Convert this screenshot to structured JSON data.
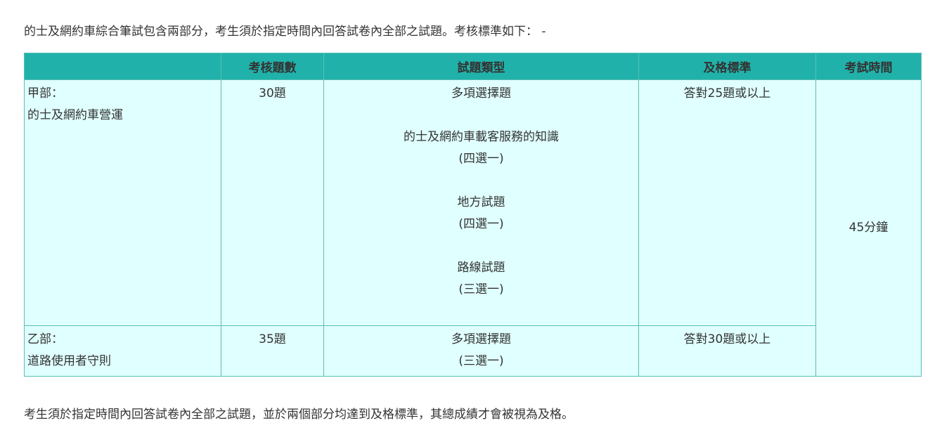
{
  "intro": "的士及網約車綜合筆試包含兩部分，考生須於指定時間內回答試卷內全部之試題。考核標準如下： -",
  "table": {
    "headers": [
      "",
      "考核題數",
      "試題類型",
      "及格標準",
      "考試時間"
    ],
    "rows": [
      {
        "part_label": "甲部：",
        "part_name": "的士及網約車營運",
        "count": "30題",
        "type_lines": [
          "多項選擇題",
          "",
          "的士及網約車載客服務的知識",
          "(四選一)",
          "",
          "地方試題",
          "(四選一)",
          "",
          "路線試題",
          "(三選一)"
        ],
        "pass": "答對25題或以上"
      },
      {
        "part_label": "乙部：",
        "part_name": "道路使用者守則",
        "count": "35題",
        "type_lines": [
          "多項選擇題",
          "(三選一)"
        ],
        "pass": "答對30題或以上"
      }
    ],
    "exam_time": "45分鐘"
  },
  "outro": "考生須於指定時間內回答試卷內全部之試題，並於兩個部分均達到及格標準，其總成績才會被視為及格。",
  "colors": {
    "header_bg": "#20b2aa",
    "cell_bg": "#e0ffff",
    "border": "#5cbdb5",
    "text": "#333333"
  }
}
